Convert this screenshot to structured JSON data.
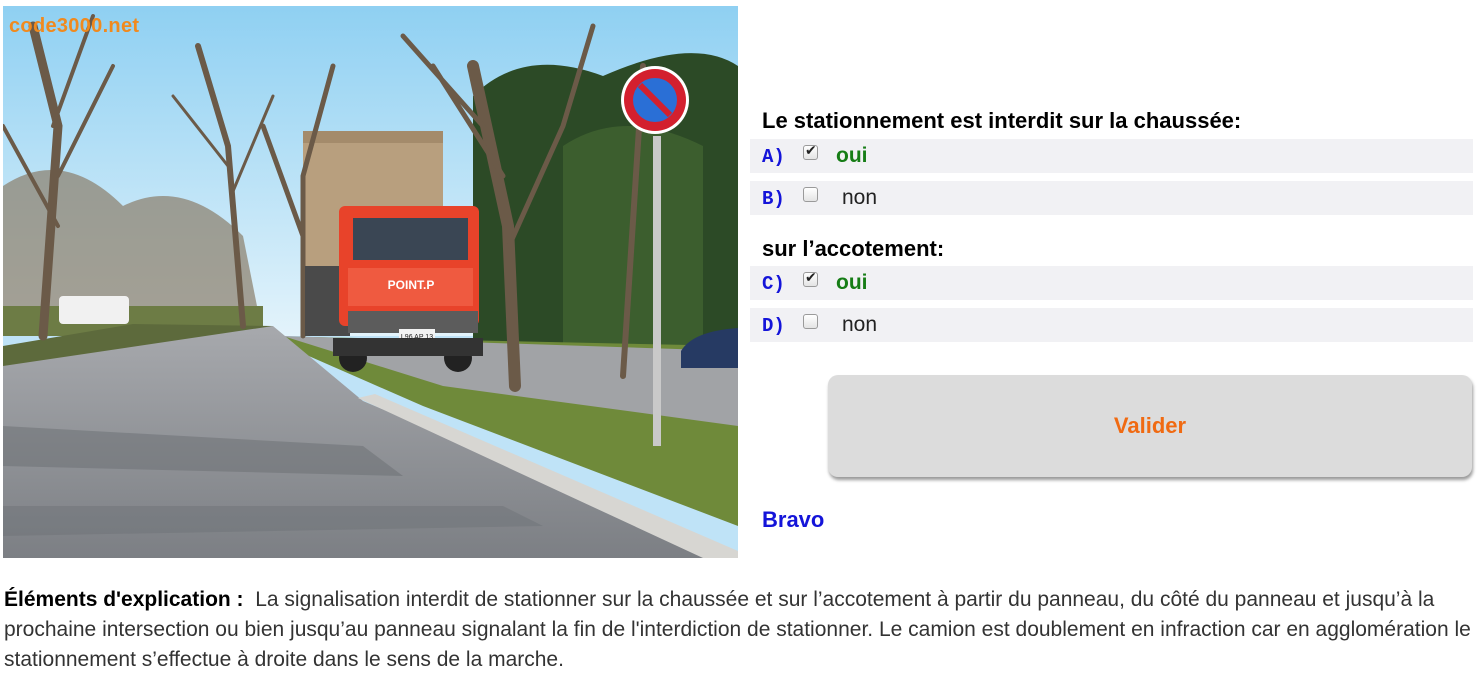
{
  "image": {
    "watermark": "code3000.net",
    "truck_brand": "POINT.P",
    "truck_plate": "L96 AP 13",
    "sign": "no-parking-sign-icon"
  },
  "question": {
    "q1_title": "Le stationnement est interdit sur la chaussée:",
    "q2_title": "sur l’accotement:",
    "options": [
      {
        "letter": "A)",
        "label": "oui",
        "checked": true
      },
      {
        "letter": "B)",
        "label": "non",
        "checked": false
      },
      {
        "letter": "C)",
        "label": "oui",
        "checked": true
      },
      {
        "letter": "D)",
        "label": "non",
        "checked": false
      }
    ],
    "submit_label": "Valider",
    "feedback": "Bravo"
  },
  "explanation": {
    "label": "Éléments d'explication :",
    "text": "La signalisation interdit de stationner sur la chaussée et sur l’accotement à partir du panneau, du côté du panneau et jusqu’à la prochaine intersection ou bien jusqu’au panneau signalant la fin de l'interdiction de stationner. Le camion est doublement en infraction car en agglomération le stationnement s’effectue à droite dans le sens de la marche."
  },
  "colors": {
    "answer_letter": "#1414d9",
    "correct_answer": "#167d16",
    "submit_text": "#f06a12",
    "feedback": "#1414d9",
    "watermark": "#f08a1e",
    "truck_cab": "#e8432a",
    "sign_red": "#d3202e",
    "sign_blue": "#2a6fd6"
  }
}
